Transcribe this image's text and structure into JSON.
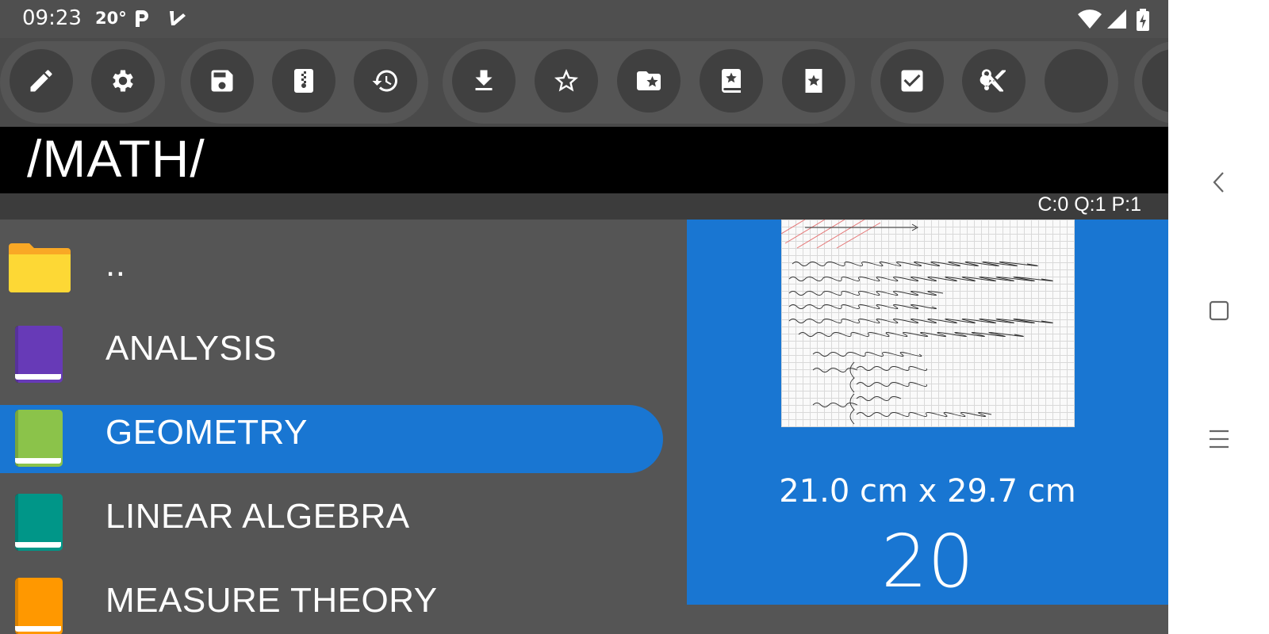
{
  "status_bar": {
    "time": "09:23",
    "temperature": "20°",
    "icons": [
      "parking-icon",
      "delivery-check-icon",
      "wifi-icon",
      "signal-icon",
      "battery-charging-icon"
    ]
  },
  "toolbar": {
    "groups": [
      [
        "pencil-icon",
        "settings-icon"
      ],
      [
        "save-icon",
        "zip-file-icon",
        "history-icon"
      ],
      [
        "download-icon",
        "star-outline-icon",
        "folder-star-icon",
        "book-star-icon",
        "page-star-icon"
      ],
      [
        "checkbox-icon",
        "scissors-icon",
        "empty-icon"
      ]
    ]
  },
  "header": {
    "title": "/MATH/"
  },
  "counters": "C:0 Q:1 P:1",
  "file_list": {
    "items": [
      {
        "label": "..",
        "type": "folder",
        "color": "#fdd835"
      },
      {
        "label": "ANALYSIS",
        "type": "notebook",
        "color": "#673ab7"
      },
      {
        "label": "GEOMETRY",
        "type": "notebook",
        "color": "#8bc34a",
        "selected": true
      },
      {
        "label": "LINEAR ALGEBRA",
        "type": "notebook",
        "color": "#009688"
      },
      {
        "label": "MEASURE THEORY",
        "type": "notebook",
        "color": "#ff9800"
      }
    ]
  },
  "preview": {
    "page_size": "21.0 cm x 29.7 cm",
    "page_count": "20"
  },
  "colors": {
    "accent": "#1976d2",
    "background": "#555555",
    "toolbar": "#4a4a4a"
  }
}
